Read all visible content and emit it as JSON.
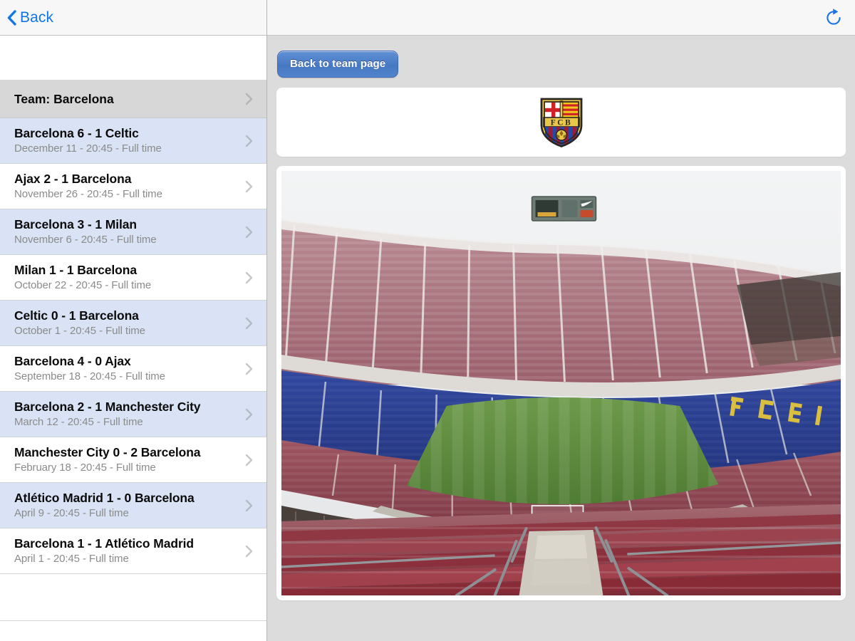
{
  "master": {
    "navbar": {
      "back_label": "Back",
      "back_icon": "chevron-left-icon"
    },
    "header_row": {
      "label": "Team: Barcelona",
      "accessory_icon": "chevron-right-icon"
    },
    "matches": [
      {
        "title": "Barcelona 6 - 1 Celtic",
        "subtitle": "December 11 - 20:45 - Full time",
        "highlighted": true
      },
      {
        "title": "Ajax 2 - 1 Barcelona",
        "subtitle": "November 26 - 20:45 - Full time",
        "highlighted": false
      },
      {
        "title": "Barcelona 3 - 1 Milan",
        "subtitle": "November 6 - 20:45 - Full time",
        "highlighted": true
      },
      {
        "title": "Milan 1 - 1 Barcelona",
        "subtitle": "October 22 - 20:45 - Full time",
        "highlighted": false
      },
      {
        "title": "Celtic 0 - 1 Barcelona",
        "subtitle": "October 1 - 20:45 - Full time",
        "highlighted": true
      },
      {
        "title": "Barcelona 4 - 0 Ajax",
        "subtitle": "September 18 - 20:45 - Full time",
        "highlighted": false
      },
      {
        "title": "Barcelona 2 - 1 Manchester City",
        "subtitle": "March 12 - 20:45 - Full time",
        "highlighted": true
      },
      {
        "title": "Manchester City 0 - 2 Barcelona",
        "subtitle": "February 18 - 20:45 - Full time",
        "highlighted": false
      },
      {
        "title": "Atlético Madrid 1 - 0 Barcelona",
        "subtitle": "April 9 - 20:45 - Full time",
        "highlighted": true
      },
      {
        "title": "Barcelona 1 - 1 Atlético Madrid",
        "subtitle": "April 1 - 20:45 - Full time",
        "highlighted": false
      }
    ]
  },
  "detail": {
    "navbar": {
      "refresh_icon": "refresh-icon"
    },
    "back_to_team_button": "Back to team page",
    "crest": {
      "name": "fc-barcelona-crest",
      "initials": "F C B",
      "colors": {
        "gold": "#e8c74b",
        "gold_dark": "#b99425",
        "outline": "#2a2722",
        "cross_red": "#d02128",
        "catalan_red": "#d02128",
        "catalan_yellow": "#f2c71c",
        "blue": "#254aa5",
        "garnet": "#9b1b3a",
        "white": "#ffffff"
      }
    },
    "photo": {
      "name": "camp-nou-stadium-photo",
      "alt": "Camp Nou stadium interior seen from upper tier",
      "colors": {
        "sky": "#eef0f1",
        "pitch": "#5d8a3e",
        "seat_garnet": "#9e5b66",
        "seat_red": "#8e2733",
        "tier_blue": "#2e49a3",
        "mosaic_yellow": "#e8c93a",
        "concrete": "#c9c6bd"
      }
    }
  },
  "theme": {
    "accent_blue": "#007aff",
    "row_highlight": "#d9e3f5",
    "row_header_bg": "#d7d7d7",
    "detail_bg": "#dcdcdc",
    "navbar_bg": "#f7f7f7",
    "separator": "#d4d4d4",
    "subtitle_gray": "#8b8b8b"
  }
}
